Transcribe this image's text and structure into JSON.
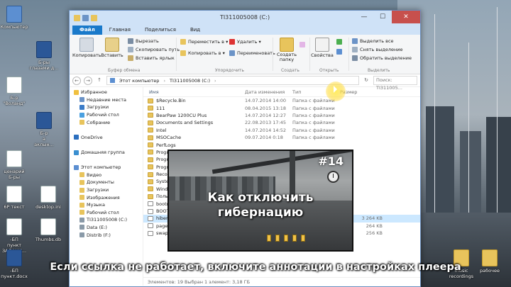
{
  "desktop": {
    "icons_left": [
      {
        "label": "Компьютер",
        "kind": "pc"
      },
      {
        "label": "Б-ры\nглазами д...",
        "kind": "word"
      },
      {
        "label": "Б-р\n\"Воланд\"",
        "kind": "doc"
      },
      {
        "label": "Б-р\nа\nаклын...",
        "kind": "word"
      },
      {
        "label": "ценарий\nБ-ры",
        "kind": "doc"
      },
      {
        "label": "6Р текст",
        "kind": "doc"
      },
      {
        "label": "-БП\nпункт\nЗАДАНИ...",
        "kind": "doc"
      },
      {
        "label": "-БП\nпункт.docx",
        "kind": "word"
      }
    ],
    "icons_right": [
      {
        "label": "music\nrecordings",
        "kind": "folder"
      },
      {
        "label": "рабочее",
        "kind": "folder"
      }
    ],
    "extra_labels": [
      "Thumbs.db",
      "desktop.ini"
    ]
  },
  "window": {
    "title": "TI311005008 (C:)",
    "controls": {
      "minimize": "—",
      "maximize": "☐",
      "close": "✕"
    },
    "tabs": [
      "Файл",
      "Главная",
      "Поделиться",
      "Вид"
    ],
    "ribbon": {
      "copy": "Копировать",
      "paste": "Вставить",
      "cut": "Вырезать",
      "copy_path": "Скопировать путь",
      "paste_shortcut": "Вставить ярлык",
      "move_to": "Переместить в ▾",
      "copy_to": "Копировать в ▾",
      "delete": "Удалить ▾",
      "rename": "Переименовать",
      "new_folder": "Создать\nпапку",
      "properties": "Свойства",
      "select_all": "Выделить все",
      "select_none": "Снять выделение",
      "invert": "Обратить выделение",
      "group_clipboard": "Буфер обмена",
      "group_organize": "Упорядочить",
      "group_create": "Создать",
      "group_open": "Открыть",
      "group_select": "Выделить"
    },
    "address": {
      "back": "←",
      "forward": "→",
      "up": "↑",
      "crumbs": [
        "Этот компьютер",
        "TI311005008 (C:)"
      ],
      "search_placeholder": "Поиск: TI311005..."
    },
    "nav": [
      {
        "label": "Избранное",
        "color": "#f0c040"
      },
      {
        "label": "Недавние места",
        "color": "#6b93c7"
      },
      {
        "label": "Загрузки",
        "color": "#3b7cc8"
      },
      {
        "label": "Рабочий стол",
        "color": "#4aa0e0"
      },
      {
        "label": "Собрание",
        "color": "#e8c45c"
      },
      {
        "label": "",
        "color": "transparent"
      },
      {
        "label": "OneDrive",
        "color": "#2c6fbf"
      },
      {
        "label": "",
        "color": "transparent"
      },
      {
        "label": "Домашняя группа",
        "color": "#3a8fd0"
      },
      {
        "label": "",
        "color": "transparent"
      },
      {
        "label": "Этот компьютер",
        "color": "#5c8fd1"
      },
      {
        "label": "Видео",
        "color": "#e8c45c"
      },
      {
        "label": "Документы",
        "color": "#e8c45c"
      },
      {
        "label": "Загрузки",
        "color": "#e8c45c"
      },
      {
        "label": "Изображения",
        "color": "#e8c45c"
      },
      {
        "label": "Музыка",
        "color": "#e8c45c"
      },
      {
        "label": "Рабочий стол",
        "color": "#e8c45c"
      },
      {
        "label": "TI311005008 (C:)",
        "color": "#8a9aa8"
      },
      {
        "label": "Data (E:)",
        "color": "#8a9aa8"
      },
      {
        "label": "Distrib (F:)",
        "color": "#8a9aa8"
      }
    ],
    "columns": {
      "name": "Имя",
      "date": "Дата изменения",
      "type": "Тип",
      "size": "Размер"
    },
    "files": [
      {
        "name": "$Recycle.Bin",
        "date": "14.07.2014 14:00",
        "type": "Папка с файлами",
        "size": "",
        "sys": false
      },
      {
        "name": "111",
        "date": "08.04.2015 13:18",
        "type": "Папка с файлами",
        "size": "",
        "sys": false
      },
      {
        "name": "BearPaw 1200CU Plus",
        "date": "14.07.2014 12:27",
        "type": "Папка с файлами",
        "size": "",
        "sys": false
      },
      {
        "name": "Documents and Settings",
        "date": "22.08.2013 17:45",
        "type": "Папка с файлами",
        "size": "",
        "sys": false
      },
      {
        "name": "Intel",
        "date": "14.07.2014 14:52",
        "type": "Папка с файлами",
        "size": "",
        "sys": false
      },
      {
        "name": "MSOCache",
        "date": "09.07.2014 0:18",
        "type": "Папка с файлами",
        "size": "",
        "sys": false
      },
      {
        "name": "PerfLogs",
        "date": "",
        "type": "",
        "size": "",
        "sys": false
      },
      {
        "name": "Program Files",
        "date": "",
        "type": "",
        "size": "",
        "sys": false
      },
      {
        "name": "Program Files (x86)",
        "date": "",
        "type": "",
        "size": "",
        "sys": false
      },
      {
        "name": "ProgramData",
        "date": "",
        "type": "",
        "size": "",
        "sys": false
      },
      {
        "name": "Recovery",
        "date": "",
        "type": "",
        "size": "",
        "sys": false
      },
      {
        "name": "System Volume Information",
        "date": "",
        "type": "",
        "size": "",
        "sys": false
      },
      {
        "name": "Windows",
        "date": "",
        "type": "",
        "size": "",
        "sys": false
      },
      {
        "name": "Пользователи",
        "date": "",
        "type": "",
        "size": "",
        "sys": false
      },
      {
        "name": "bootmgr",
        "date": "",
        "type": "",
        "size": "",
        "sys": true
      },
      {
        "name": "BOOTNXT",
        "date": "",
        "type": "",
        "size": "",
        "sys": true
      },
      {
        "name": "hiberfil.sys",
        "date": "",
        "type": "",
        "size": "3 264 KB",
        "sys": true,
        "selected": true
      },
      {
        "name": "pagefile.sys",
        "date": "",
        "type": "",
        "size": "264 KB",
        "sys": true
      },
      {
        "name": "swapfile.sys",
        "date": "",
        "type": "",
        "size": "256 KB",
        "sys": true
      }
    ],
    "status": "Элементов: 19   Выбран 1 элемент: 3,18 ГБ"
  },
  "video_overlay": {
    "number": "#14",
    "title_line1": "Как отключить",
    "title_line2": "гибернацию"
  },
  "subtitle": "Если ссылка не работает, включите аннотации в настройках плеера"
}
